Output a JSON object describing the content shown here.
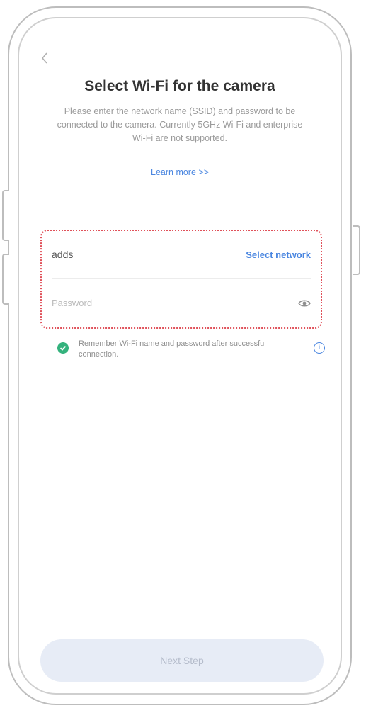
{
  "header": {
    "back_icon": "chevron-left-icon",
    "title": "Select Wi-Fi for the camera",
    "subtitle": "Please enter the network name (SSID) and password to be connected to the camera. Currently 5GHz Wi-Fi and enterprise Wi-Fi are not supported.",
    "learn_more": "Learn more >>"
  },
  "form": {
    "ssid_value": "adds",
    "select_network_label": "Select network",
    "password_placeholder": "Password",
    "password_value": "",
    "eye_icon": "eye-icon",
    "highlight_color": "#e0515a"
  },
  "remember": {
    "checked": true,
    "text": "Remember Wi-Fi name and password after successful connection.",
    "check_color": "#34b27d",
    "info_icon": "info-icon"
  },
  "footer": {
    "next_label": "Next Step"
  },
  "colors": {
    "accent": "#4a86e0",
    "button_bg": "#e7ecf6"
  }
}
